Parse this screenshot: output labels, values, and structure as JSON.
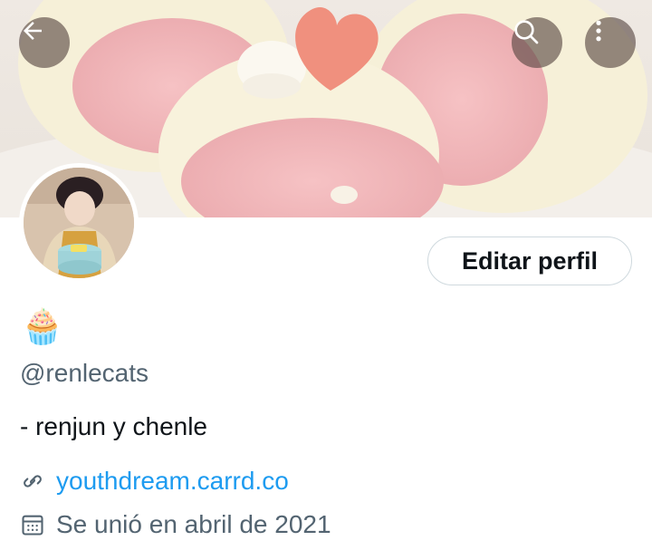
{
  "header": {
    "back_icon": "arrow-left-icon",
    "search_icon": "search-icon",
    "more_icon": "more-vertical-icon",
    "banner_alt": "pink roll cake banner"
  },
  "profile": {
    "avatar_alt": "profile picture",
    "display_name_emoji": "🧁",
    "handle": "@renlecats",
    "bio": "- renjun y chenle",
    "link": "youthdream.carrd.co",
    "joined": "Se unió en abril de 2021"
  },
  "actions": {
    "edit_profile_label": "Editar perfil"
  },
  "colors": {
    "link": "#1d9bf0",
    "secondary_text": "#536471",
    "button_border": "#cfd9de"
  }
}
